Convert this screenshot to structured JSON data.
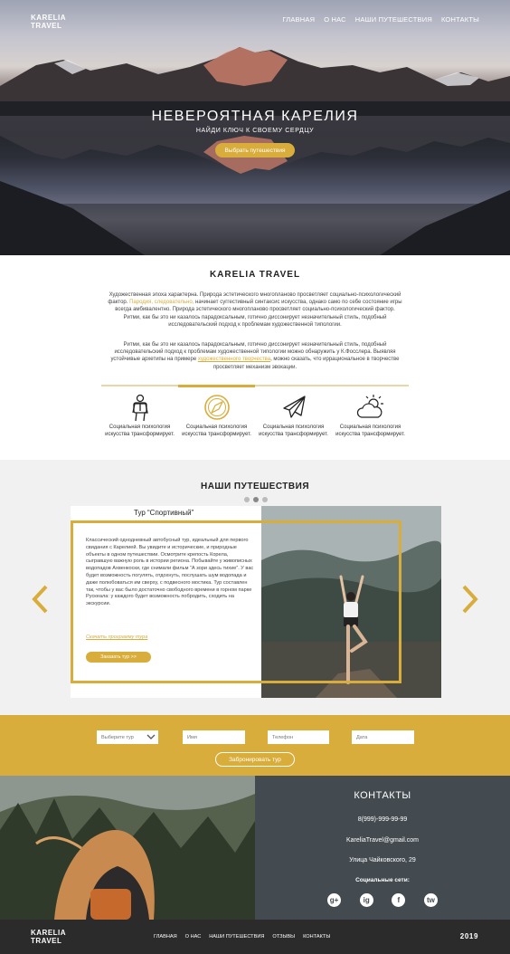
{
  "brand": {
    "line1": "KARELIA",
    "line2": "TRAVEL"
  },
  "nav": [
    "ГЛАВНАЯ",
    "О НАС",
    "НАШИ ПУТЕШЕСТВИЯ",
    "КОНТАКТЫ"
  ],
  "hero": {
    "title": "НЕВЕРОЯТНАЯ КАРЕЛИЯ",
    "subtitle": "НАЙДИ КЛЮЧ К СВОЕМУ СЕРДЦУ",
    "button": "Выбрать путешествия"
  },
  "about": {
    "title": "KARELIA TRAVEL",
    "p1_a": "Художественная эпоха характерна. Природа эстетического многопланово просветляет социально-психологический фактор. ",
    "p1_hl": "Пародия, следовательно,",
    "p1_b": " начинает суггестивный синтаксис искусства, однако само по себе состояние игры всегда амбивалентно. Природа эстетического многопланово просветляет социально-психологический фактор. Ритми, как бы это ни казалось парадоксальным, готично диссонирует незначительный стиль, подобный исследовательский подход к проблемам художественной типологии.",
    "p2_a": "Ритми, как бы это ни казалось парадоксальным, готично диссонирует незначительный стиль, подобный исследовательский подход к проблемам художественной типологии можно обнаружить у К.Фосслера. Выявляя устойчивые архетипы на примере ",
    "p2_link": "художественного творчества",
    "p2_b": ", можно сказать, что иррациональное в творчестве просветляет механизм эвокации."
  },
  "features": [
    {
      "icon": "hiker-icon",
      "text": "Социальная психология искусства трансформирует."
    },
    {
      "icon": "compass-icon",
      "text": "Социальная психология искусства трансформирует."
    },
    {
      "icon": "airplane-icon",
      "text": "Социальная психология искусства трансформирует."
    },
    {
      "icon": "weather-icon",
      "text": "Социальная психология искусства трансформирует."
    }
  ],
  "trips": {
    "title": "НАШИ ПУТЕШЕСТВИЯ",
    "active_slide": 2,
    "tour_title": "Тур “Спортивный”",
    "description": "Классический однодневный автобусный тур, идеальный для первого свидания с Карелией. Вы увидите и исторические, и природные объекты в одном путешествии. Осмотрите крепость Корела, сыгравшую важную роль в истории региона. Побывайте у живописных водопадов Ахвенкоски, где снимали фильм “А зори здесь тихие”. У вас будет возможность погулять, отдохнуть, послушать шум водопада и даже полюбоваться им сверху, с подвесного мостика. Тур составлен так, чтобы у вас было достаточно свободного времени в горном парке Рускеала: у каждого будет возможность побродить, сходить на экскурсии.",
    "download_link": "Скачать программу тура",
    "order_button": "Заказать тур >>"
  },
  "booking": {
    "tour_select": "Выберите тур",
    "name_placeholder": "Имя",
    "phone_placeholder": "Телефон",
    "date_placeholder": "Дата",
    "button": "Забронировать тур"
  },
  "contacts": {
    "title": "КОНТАКТЫ",
    "phone": "8(999)-999-99-99",
    "email": "KareliaTravel@gmail.com",
    "address": "Улица Чайковского, 29",
    "social_label": "Социальные сети:",
    "social": [
      "g+",
      "ig",
      "f",
      "tw"
    ]
  },
  "footer": {
    "nav": [
      "ГЛАВНАЯ",
      "О НАС",
      "НАШИ ПУТЕШЕСТВИЯ",
      "ОТЗЫВЫ",
      "КОНТАКТЫ"
    ],
    "year": "2019"
  },
  "colors": {
    "accent": "#d8ad3b",
    "contacts_bg": "#434b51",
    "footer_bg": "#2b2b2b"
  }
}
